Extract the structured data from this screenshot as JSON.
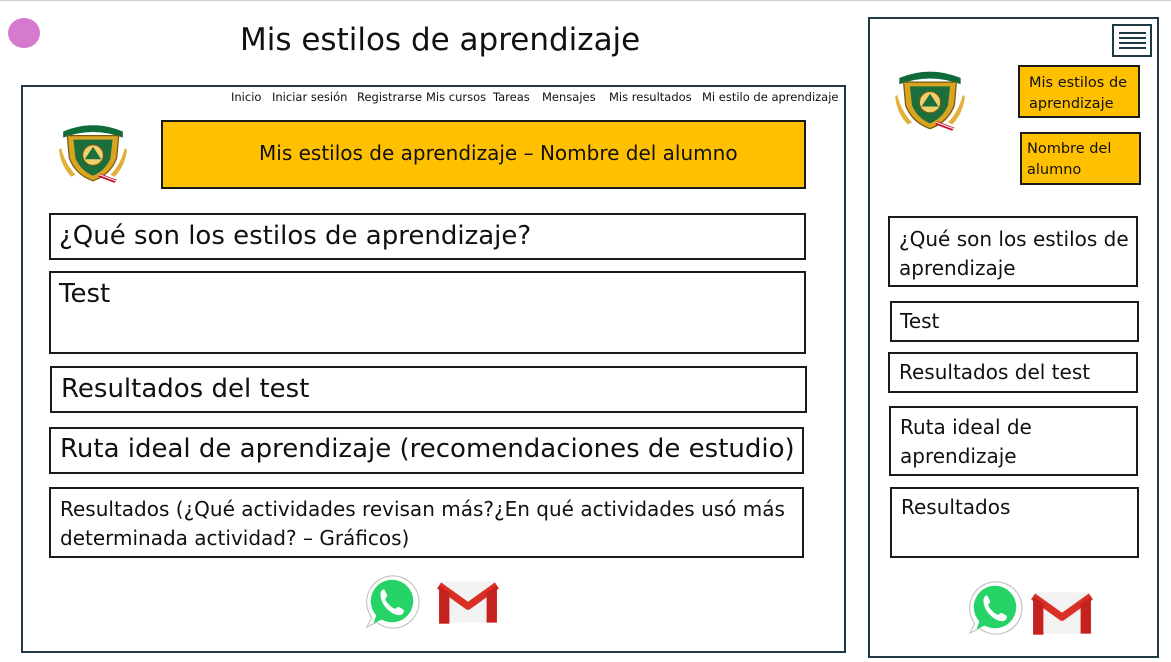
{
  "page_title": "Mis estilos de aprendizaje",
  "desktop": {
    "nav": [
      "Inicio",
      "Iniciar sesión",
      "Registrarse",
      "Mis cursos",
      "Tareas",
      "Mensajes",
      "Mis resultados",
      "Mi estilo de aprendizaje"
    ],
    "header_banner": "Mis estilos de aprendizaje – Nombre del alumno",
    "sections": [
      "¿Qué son los estilos de aprendizaje?",
      "Test",
      "Resultados del test",
      "Ruta ideal de aprendizaje (recomendaciones de estudio)",
      "Resultados (¿Qué actividades revisan más?¿En qué actividades usó más determinada actividad? – Gráficos)"
    ]
  },
  "mobile": {
    "banner_title": "Mis estilos de aprendizaje",
    "banner_student": "Nombre del alumno",
    "sections": [
      "¿Qué son los estilos de aprendizaje",
      "Test",
      "Resultados del test",
      "Ruta ideal de aprendizaje",
      "Resultados"
    ]
  },
  "colors": {
    "accent_yellow": "#ffc000",
    "frame": "#1f3a45",
    "marker": "#d67ad0",
    "whatsapp": "#25d366",
    "gmail_red": "#ea4335"
  },
  "icons": [
    "university-logo-icon",
    "whatsapp-icon",
    "gmail-icon",
    "hamburger-menu-icon"
  ]
}
